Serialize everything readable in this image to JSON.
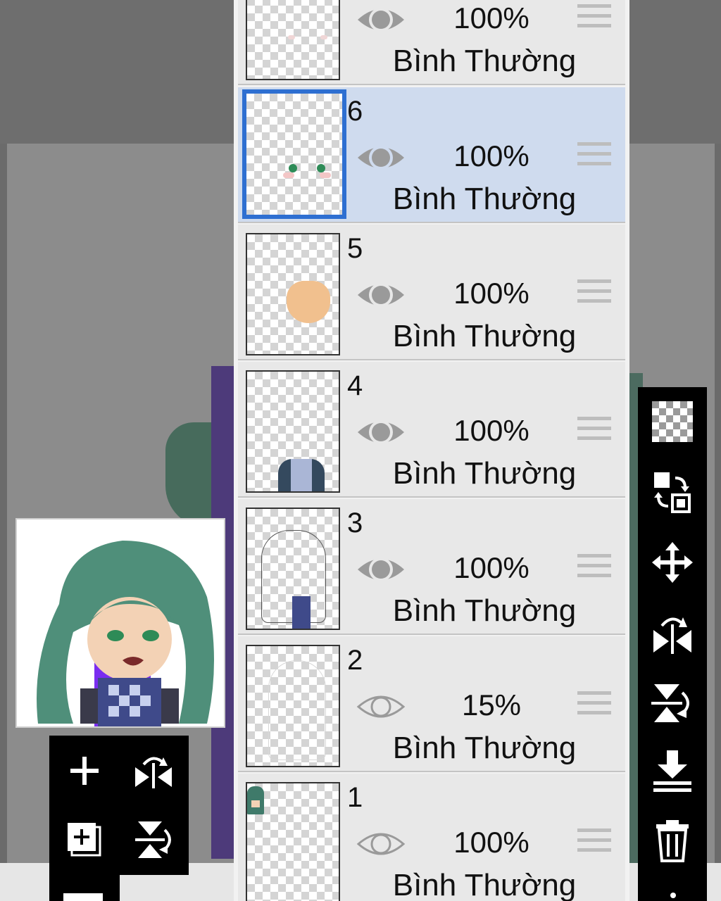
{
  "layers": [
    {
      "number": "",
      "opacity": "100%",
      "mode": "Bình Thường",
      "visible": true,
      "selected": false
    },
    {
      "number": "6",
      "opacity": "100%",
      "mode": "Bình Thường",
      "visible": true,
      "selected": true
    },
    {
      "number": "5",
      "opacity": "100%",
      "mode": "Bình Thường",
      "visible": true,
      "selected": false
    },
    {
      "number": "4",
      "opacity": "100%",
      "mode": "Bình Thường",
      "visible": true,
      "selected": false
    },
    {
      "number": "3",
      "opacity": "100%",
      "mode": "Bình Thường",
      "visible": true,
      "selected": false
    },
    {
      "number": "2",
      "opacity": "15%",
      "mode": "Bình Thường",
      "visible": false,
      "selected": false
    },
    {
      "number": "1",
      "opacity": "100%",
      "mode": "Bình Thường",
      "visible": false,
      "selected": false
    }
  ],
  "colors": {
    "selected_row": "#cfdbee",
    "selection_border": "#2e6fd1",
    "toolbar": "#000000"
  },
  "right_toolbar": {
    "icons": [
      "transparency-checker-icon",
      "swap-layers-icon",
      "move-icon",
      "flip-horizontal-icon",
      "flip-vertical-icon",
      "merge-down-icon",
      "trash-icon"
    ]
  },
  "left_toolbar": {
    "icons": [
      "add-layer-icon",
      "flip-horizontal-icon",
      "duplicate-layer-icon",
      "flip-vertical-icon"
    ]
  }
}
